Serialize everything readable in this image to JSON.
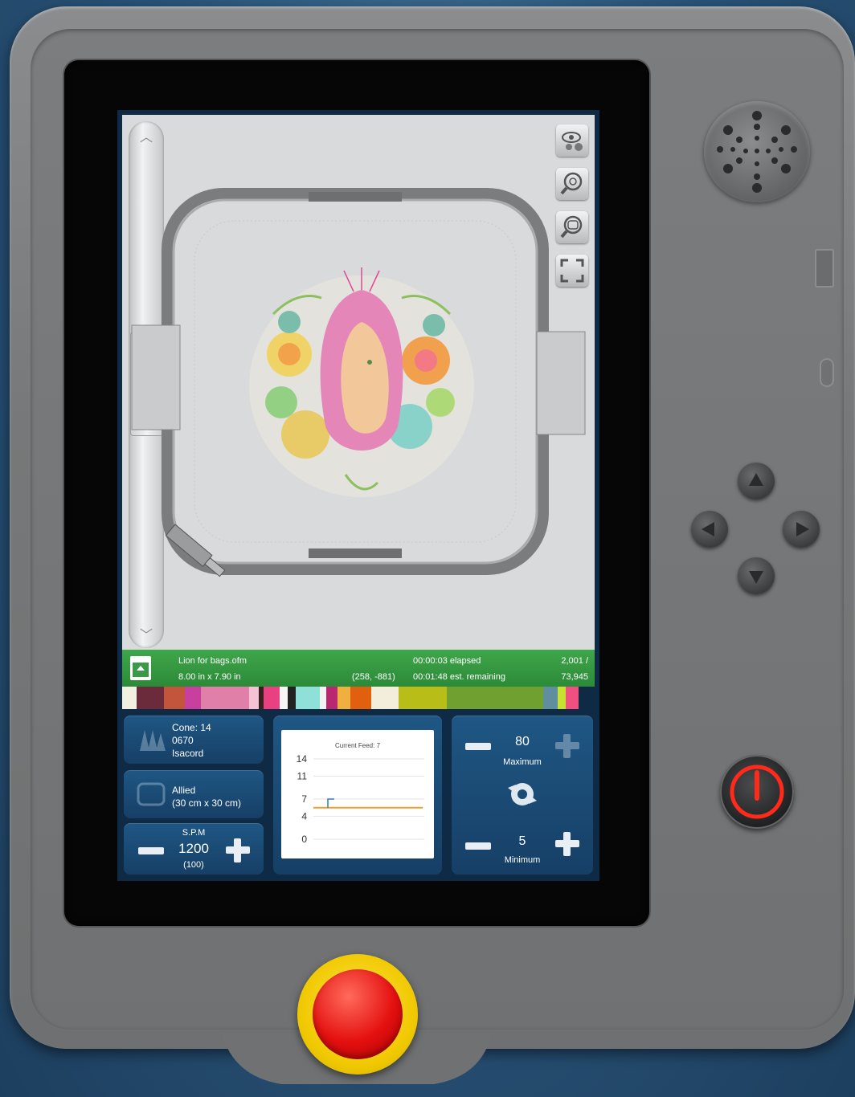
{
  "file": {
    "name": "Lion for bags.ofm",
    "size": "8.00 in x 7.90 in",
    "coords": "(258, -881)",
    "elapsed": "00:00:03 elapsed",
    "remaining": "00:01:48 est. remaining",
    "stitch_current": "2,001 /",
    "stitch_total": "73,945"
  },
  "thread": {
    "cone": "Cone: 14",
    "code": "0670",
    "brand": "Isacord"
  },
  "hoop": {
    "name": "Allied",
    "size": "(30 cm x 30 cm)"
  },
  "spm": {
    "label": "S.P.M",
    "value": "1200",
    "sub": "(100)"
  },
  "feed": {
    "max_value": "80",
    "max_label": "Maximum",
    "min_value": "5",
    "min_label": "Minimum"
  },
  "chart_data": {
    "type": "line",
    "title": "Current Feed: 7",
    "yticks": [
      "14",
      "11",
      "7",
      "4",
      "0"
    ],
    "ylim": [
      0,
      14
    ],
    "grid": true,
    "series": [
      {
        "values": [
          5.5,
          5.5
        ],
        "color": "#f0a030"
      },
      {
        "values": [
          5.5,
          7
        ],
        "color": "#2b7fc0"
      }
    ]
  },
  "icons": {
    "view_settings": "eye-gear-icon",
    "zoom_fit": "zoom-target-icon",
    "zoom_hoop": "zoom-hoop-icon",
    "fullscreen": "fullscreen-icon",
    "speaker": "speaker-grille-icon",
    "power": "power-icon",
    "stop": "emergency-stop-button",
    "cone": "thread-cones-icon",
    "hoop": "hoop-icon",
    "feed": "feed-motor-icon"
  },
  "colors": {
    "info_bar": "#2f8f3b",
    "panel": "#1a4b75",
    "stop_ring": "#f5d400",
    "stop_center": "#e01010",
    "power_ring": "#e02020"
  },
  "thread_colors": [
    "#f2f0e0",
    "#6b2b3a",
    "#c2553b",
    "#c83fa0",
    "#e07fa8",
    "#f4c2d4",
    "#3a1f1f",
    "#e84080",
    "#f6f6f6",
    "#222222",
    "#8fe0d8",
    "#f3f3f3",
    "#b82870",
    "#f0b040",
    "#e06010",
    "#f2eedb",
    "#b9bd18",
    "#6fa030",
    "#5f8f9f",
    "#c8e030",
    "#f05080"
  ]
}
